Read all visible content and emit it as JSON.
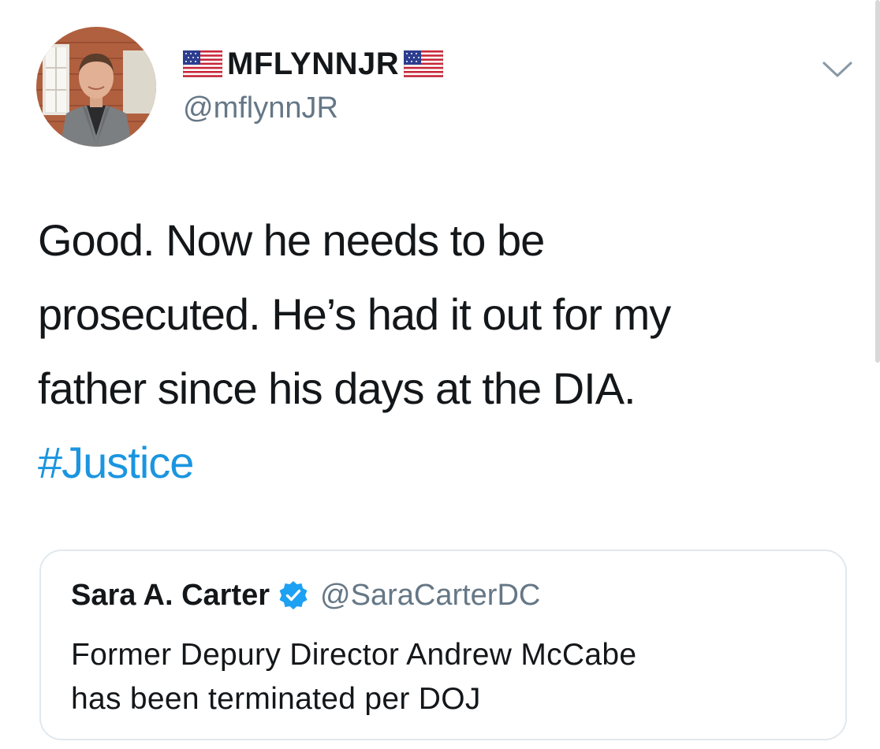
{
  "author": {
    "display_name": "MFLYNNJR",
    "handle": "@mflynnJR",
    "name_decorations": [
      "us-flag-icon",
      "us-flag-icon"
    ]
  },
  "tweet": {
    "lines": [
      "Good.  Now he needs to be",
      "prosecuted.  He’s had it out for my",
      "father since his days at the DIA."
    ],
    "hashtag": "#Justice"
  },
  "quoted_tweet": {
    "name": "Sara A. Carter",
    "verified": true,
    "handle": "@SaraCarterDC",
    "lines": [
      "Former Depury Director Andrew McCabe",
      "has been terminated per DOJ"
    ]
  },
  "colors": {
    "text": "#14171a",
    "secondary": "#657786",
    "link": "#1b95e0",
    "border": "#e1e8ed",
    "verified": "#1da1f2"
  },
  "icons": {
    "menu": "chevron-down-icon",
    "verified": "verified-badge-icon"
  }
}
